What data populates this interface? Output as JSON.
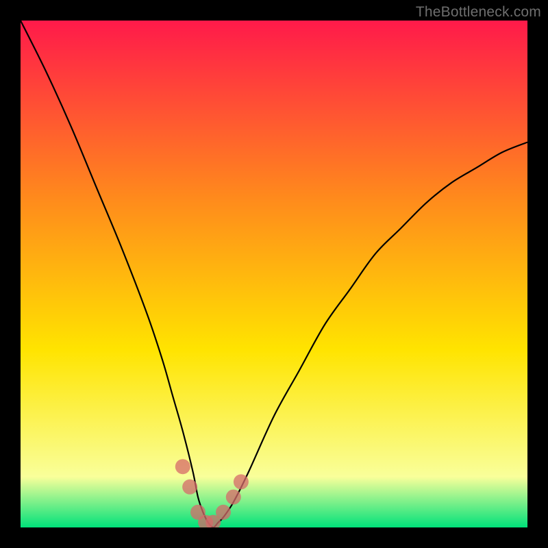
{
  "watermark": "TheBottleneck.com",
  "colors": {
    "frame": "#000000",
    "grad_top": "#ff1a4a",
    "grad_mid1": "#ff8a1c",
    "grad_mid2": "#ffe400",
    "grad_near_bottom": "#f9ff9a",
    "grad_bottom": "#00e17a",
    "curve": "#000000",
    "marker": "#d66a6a"
  },
  "chart_data": {
    "type": "line",
    "title": "",
    "xlabel": "",
    "ylabel": "",
    "xlim": [
      0,
      100
    ],
    "ylim": [
      0,
      100
    ],
    "series": [
      {
        "name": "bottleneck-curve",
        "x": [
          0,
          5,
          10,
          15,
          20,
          25,
          28,
          30,
          32,
          34,
          35,
          36,
          37,
          38,
          39,
          40,
          42,
          45,
          50,
          55,
          60,
          65,
          70,
          75,
          80,
          85,
          90,
          95,
          100
        ],
        "y": [
          100,
          90,
          79,
          67,
          55,
          42,
          33,
          26,
          19,
          11,
          6,
          3,
          1,
          0,
          1,
          2,
          5,
          11,
          22,
          31,
          40,
          47,
          54,
          59,
          64,
          68,
          71,
          74,
          76
        ]
      }
    ],
    "markers": [
      {
        "x": 32.0,
        "y": 12
      },
      {
        "x": 33.4,
        "y": 8
      },
      {
        "x": 35.0,
        "y": 3
      },
      {
        "x": 36.5,
        "y": 1
      },
      {
        "x": 38.0,
        "y": 1
      },
      {
        "x": 40.0,
        "y": 3
      },
      {
        "x": 42.0,
        "y": 6
      },
      {
        "x": 43.5,
        "y": 9
      }
    ],
    "annotations": []
  }
}
